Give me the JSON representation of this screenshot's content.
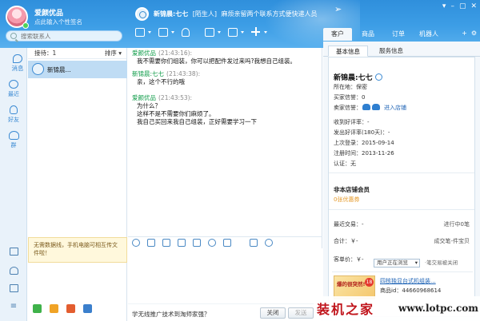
{
  "window": {
    "user_name": "爱颜优品",
    "signature": "点此输入个性签名",
    "search_placeholder": "搜索联系人",
    "contact_name": "新锦晨:七七",
    "contact_tag": "[陌生人]",
    "contact_warning": "麻烦亲留两个联系方式便快递人员",
    "controls": [
      "▾",
      "–",
      "▢",
      "✕"
    ],
    "colors": {
      "title_bg": "#3d9ee6",
      "accent": "#3b8ad3",
      "sender": "#0a9a45"
    }
  },
  "top_tabs": [
    {
      "label": "客户",
      "active": true
    },
    {
      "label": "商品",
      "active": false
    },
    {
      "label": "订单",
      "active": false
    },
    {
      "label": "机器人",
      "active": false
    }
  ],
  "top_tab_extra": [
    "+",
    "⚙"
  ],
  "toolbar": [
    "share-icon",
    "video-icon",
    "add-friend-icon",
    "screen-share-icon",
    "remote-icon",
    "app-grid-icon"
  ],
  "left_nav": [
    {
      "label": "消息",
      "icon": "message-icon"
    },
    {
      "label": "最近",
      "icon": "clock-icon"
    },
    {
      "label": "好友",
      "icon": "friend-icon"
    },
    {
      "label": "群",
      "icon": "group-icon"
    }
  ],
  "contact_list": {
    "header_left": "接待：1",
    "header_right": "排序",
    "items": [
      {
        "name": "新锦晨..."
      }
    ],
    "notice": "无需数据线，手机电脑可相互传文件啦！"
  },
  "messages": [
    {
      "sender": "爱颜优品",
      "time": "(21:43:16):",
      "lines": [
        "我不需要你们组装，你可以把配件发过来吗?我想自己组装。"
      ]
    },
    {
      "sender": "新锦晨:七七",
      "time": "(21:43:38):",
      "lines": [
        "亲，这个不行的哦"
      ]
    },
    {
      "sender": "爱颜优品",
      "time": "(21:43:53):",
      "lines": [
        "为什么？",
        "这样不是不需要你们麻烦了。",
        "我自己买回来我自己组装，正好需要学习一下"
      ]
    }
  ],
  "chat_footer": {
    "link": "学无线推广技术到淘师家强？",
    "close_label": "关闭",
    "send_label": "发送"
  },
  "info": {
    "tabs": [
      {
        "label": "基本信息",
        "active": true
      },
      {
        "label": "服务信息",
        "active": false
      }
    ],
    "name": "新锦晨:七七",
    "location": "所在地：保密",
    "buyer_credit": "买家信誉：0",
    "seller_credit": "卖家信誉：",
    "enter_shop": "进入店铺",
    "received_rate": "收到好评率：-",
    "given_rate": "发出好评率(180天)：-",
    "last_login": "上次登录：2015-09-14",
    "register_time": "注册时间：2013-11-26",
    "verify": "认证：无",
    "member_title": "非本店铺会员",
    "member_sub": "0张优惠券",
    "recent_trade_label": "最近交易：-",
    "recent_trade_right": "进行中0笔",
    "total_label": "合计：￥-",
    "total_right": "成交笔-件宝贝",
    "avg_label": "客单价：￥-",
    "browse_select": "用户正在浏览",
    "browse_note": "·笔交易被关闭",
    "product_name": "四核独显台式机组装...",
    "product_id": "商品id：44660968614",
    "product_thumb_text": "爆的很突然!",
    "product_badge": "18"
  },
  "watermark": {
    "cn": "装机之家",
    "url": "www.lotpc.com"
  }
}
